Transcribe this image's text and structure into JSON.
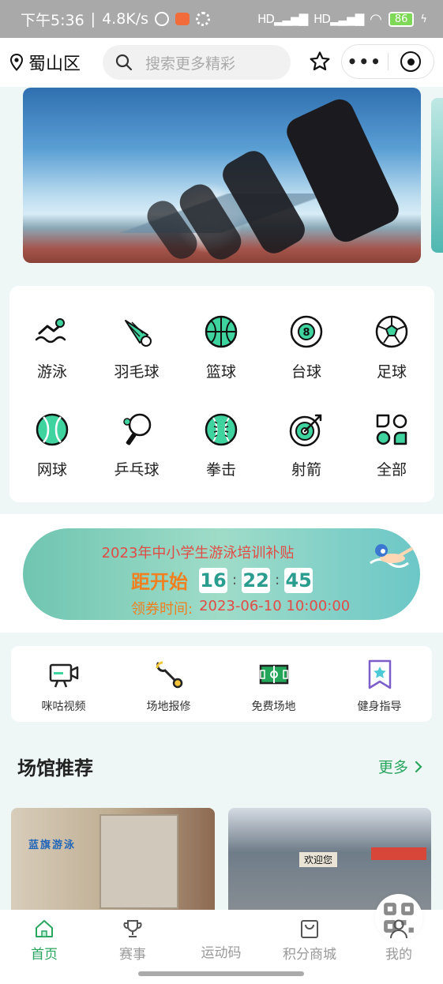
{
  "status_bar": {
    "time": "下午5:36",
    "network_speed": "4.8K/s",
    "signal": "HD",
    "battery": "86"
  },
  "top_bar": {
    "location": "蜀山区",
    "search_placeholder": "搜索更多精彩",
    "more_label": "•••"
  },
  "categories": [
    {
      "label": "游泳",
      "icon": "swimming-icon"
    },
    {
      "label": "羽毛球",
      "icon": "badminton-icon"
    },
    {
      "label": "篮球",
      "icon": "basketball-icon"
    },
    {
      "label": "台球",
      "icon": "billiards-icon"
    },
    {
      "label": "足球",
      "icon": "football-icon"
    },
    {
      "label": "网球",
      "icon": "tennis-icon"
    },
    {
      "label": "乒乓球",
      "icon": "table-tennis-icon"
    },
    {
      "label": "拳击",
      "icon": "boxing-icon"
    },
    {
      "label": "射箭",
      "icon": "archery-icon"
    },
    {
      "label": "全部",
      "icon": "all-categories-icon"
    }
  ],
  "subsidy": {
    "title": "2023年中小学生游泳培训补贴",
    "countdown_prefix": "距开始",
    "hours": "16",
    "minutes": "22",
    "seconds": "45",
    "time_label": "领券时间:",
    "time_value": "2023-06-10 10:00:00"
  },
  "services": [
    {
      "label": "咪咕视频",
      "icon": "video-camera-icon"
    },
    {
      "label": "场地报修",
      "icon": "wrench-icon"
    },
    {
      "label": "免费场地",
      "icon": "field-icon"
    },
    {
      "label": "健身指导",
      "icon": "bookmark-star-icon"
    }
  ],
  "venues": {
    "title": "场馆推荐",
    "more": "更多",
    "items": [
      {
        "sign": "蓝旗游泳"
      },
      {
        "sign": "欢迎您"
      }
    ]
  },
  "bottom_nav": [
    {
      "label": "首页",
      "icon": "home-icon",
      "active": true
    },
    {
      "label": "赛事",
      "icon": "trophy-icon",
      "active": false
    },
    {
      "label": "运动码",
      "icon": "qr-code-icon",
      "active": false
    },
    {
      "label": "积分商城",
      "icon": "shopping-bag-icon",
      "active": false
    },
    {
      "label": "我的",
      "icon": "user-icon",
      "active": false
    }
  ],
  "colors": {
    "accent": "#2aa55f",
    "icon_fill": "#3fd3a0",
    "subsidy_red": "#e24b45",
    "subsidy_orange": "#f07f20"
  }
}
